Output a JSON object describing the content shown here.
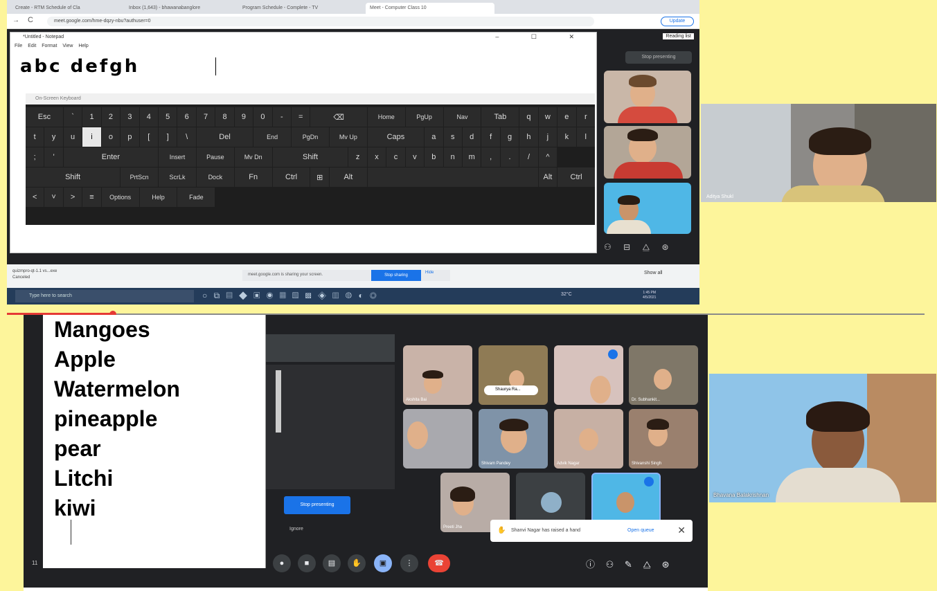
{
  "browser": {
    "tabs": [
      "Create - RTM Schedule of Cla",
      "Inbox (1,643) - bhawanabanglore",
      "Program Schedule - Complete - TV",
      "Meet - Computer Class 10"
    ],
    "url": "meet.google.com/hme-dqzy-nbu?authuser=0",
    "update_label": "Update",
    "reading_list_label": "Reading list"
  },
  "notepad": {
    "title": "*Untitled - Notepad",
    "menu": "File  Edit  Format  View  Help",
    "typed_text": "abc defgh",
    "window_buttons": "–  ☐  ✕"
  },
  "keyboard": {
    "title": "On-Screen Keyboard",
    "rows": [
      [
        "Esc",
        "`",
        "1",
        "2",
        "3",
        "4",
        "5",
        "6",
        "7",
        "8",
        "9",
        "0",
        "-",
        "=",
        "⌫",
        "Home",
        "PgUp",
        "Nav"
      ],
      [
        "Tab",
        "q",
        "w",
        "e",
        "r",
        "t",
        "y",
        "u",
        "i",
        "o",
        "p",
        "[",
        "]",
        "\\",
        "Del",
        "End",
        "PgDn",
        "Mv Up"
      ],
      [
        "Caps",
        "a",
        "s",
        "d",
        "f",
        "g",
        "h",
        "j",
        "k",
        "l",
        ";",
        "'",
        "Enter",
        "Insert",
        "Pause",
        "Mv Dn"
      ],
      [
        "Shift",
        "z",
        "x",
        "c",
        "v",
        "b",
        "n",
        "m",
        ",",
        ".",
        "/",
        "^",
        "Shift",
        "PrtScn",
        "ScrLk",
        "Dock"
      ],
      [
        "Fn",
        "Ctrl",
        "⊞",
        "Alt",
        "",
        "Alt",
        "Ctrl",
        "<",
        "˅",
        ">",
        "≡",
        "Options",
        "Help",
        "Fade"
      ]
    ],
    "highlighted_key": "i"
  },
  "meet_top": {
    "stop_presenting_label": "Stop presenting"
  },
  "downloads": {
    "file_name": "quizmpro-qt-1.1 vs...exe",
    "file_status": "Canceled",
    "sharing_text": "meet.google.com is sharing your screen.",
    "stop_sharing_label": "Stop sharing",
    "hide_label": "Hide",
    "show_all_label": "Show all"
  },
  "taskbar": {
    "search_placeholder": "Type here to search",
    "temperature": "32°C",
    "time": "1:45 PM",
    "date": "4/5/2021"
  },
  "side_cam_boy": {
    "name": "Aditya Shukl"
  },
  "wordpad": {
    "words": [
      "Mangoes",
      "Apple",
      "Watermelon",
      "pineapple",
      "pear",
      "Litchi",
      "kiwi"
    ]
  },
  "participants": [
    {
      "name": "Akshita Bai"
    },
    {
      "name": "Shaurya Ra..."
    },
    {
      "name": ""
    },
    {
      "name": "Dr. Subhankit..."
    },
    {
      "name": ""
    },
    {
      "name": "Shivam Pandey"
    },
    {
      "name": "Advik Nagar"
    },
    {
      "name": "Shivanshi Singh"
    },
    {
      "name": "Preeti Jha"
    },
    {
      "name": ""
    },
    {
      "name": ""
    }
  ],
  "meet_bottom": {
    "stop_presenting_label": "Stop presenting",
    "ignore_label": "Ignore",
    "toast_text": "Shanvi Nagar has raised a hand",
    "toast_open": "Open queue",
    "time_label": "11"
  },
  "side_cam_teacher": {
    "name": "Bhavana Balakrishnan"
  },
  "colors": {
    "page_background": "#fdf59b",
    "meet_dark": "#202124",
    "accent_blue": "#1a73e8",
    "end_call_red": "#ea4335"
  }
}
